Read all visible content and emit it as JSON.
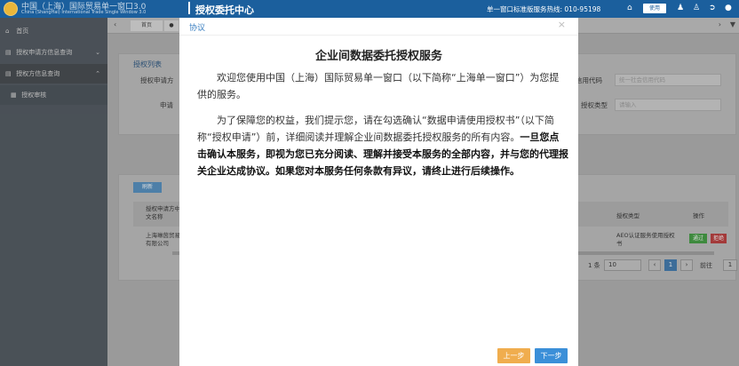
{
  "header": {
    "logo_cn": "中国（上海）国际贸易单一窗口3.0",
    "logo_en": "China (ShangHai) International Trade Single Window 3.0",
    "title": "授权委托中心",
    "hotline": "单一窗口标准版服务热线: 010-95198",
    "badge": "使用"
  },
  "sidebar": {
    "items": [
      {
        "label": "首页"
      },
      {
        "label": "授权申请方信息查询"
      },
      {
        "label": "授权方信息查询"
      },
      {
        "label": "授权审核"
      }
    ]
  },
  "tabs": {
    "home": "首页"
  },
  "background": {
    "panel_title": "授权列表",
    "field1_label": "授权申请方",
    "field2_label": "申请",
    "field3_label": "信用代码",
    "field3_placeholder": "统一社会信用代码",
    "field4_label": "授权类型",
    "field4_placeholder": "请输入",
    "refresh": "刷新",
    "col_name": "授权申请方中文名称",
    "col_type": "授权类型",
    "col_op": "操作",
    "row_name": "上海琳茵贸易有限公司",
    "row_type": "AEO认证服务使用授权书",
    "btn_pass": "通过",
    "btn_reject": "拒绝",
    "pager_total": "1 条",
    "pager_size": "10",
    "pager_page": "1",
    "pager_goto": "前往",
    "pager_goto_value": "1"
  },
  "modal": {
    "title": "协议",
    "close": "×",
    "heading": "企业间数据委托授权服务",
    "para1": "欢迎您使用中国（上海）国际贸易单一窗口（以下简称“上海单一窗口”）为您提供的服务。",
    "para2_normal": "为了保障您的权益，我们提示您，请在勾选确认“数据申请使用授权书”（以下简称“授权申请”）前，详细阅读并理解企业间数据委托授权服务的所有内容。",
    "para2_bold": "一旦您点击确认本服务，即视为您已充分阅读、理解并接受本服务的全部内容，并与您的代理报关企业达成协议。如果您对本服务任何条款有异议，请终止进行后续操作。",
    "btn_prev": "上一步",
    "btn_next": "下一步"
  },
  "colors": {
    "header_bg": "#1b5f9d",
    "modal_title": "#3a7fc1",
    "btn_prev": "#f0ad4e",
    "btn_next": "#3b8fd8"
  }
}
